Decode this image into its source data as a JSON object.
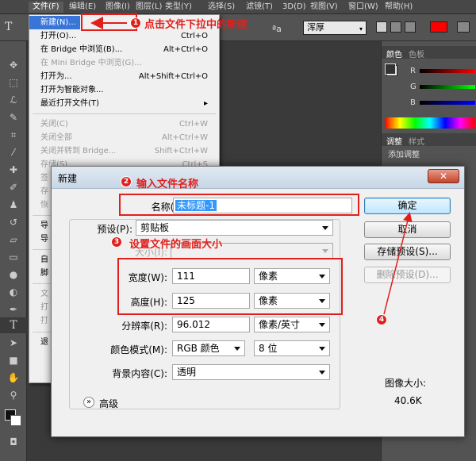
{
  "menubar": {
    "items": [
      "文件(F)",
      "编辑(E)",
      "图像(I)",
      "图层(L)",
      "类型(Y)",
      "选择(S)",
      "滤镜(T)",
      "3D(D)",
      "视图(V)",
      "窗口(W)",
      "帮助(H)"
    ]
  },
  "options_bar": {
    "text_tool_letter": "T",
    "font_size_glyph": "ªa",
    "antialias_value": "浑厚",
    "accent_color": "#ff0000"
  },
  "file_menu": {
    "items": [
      {
        "label": "新建(N)...",
        "shortcut": "",
        "disabled": false,
        "highlighted": true
      },
      {
        "label": "打开(O)...",
        "shortcut": "Ctrl+O",
        "disabled": false
      },
      {
        "label": "在 Bridge 中浏览(B)...",
        "shortcut": "Alt+Ctrl+O",
        "disabled": false
      },
      {
        "label": "在 Mini Bridge 中浏览(G)...",
        "shortcut": "",
        "disabled": true
      },
      {
        "label": "打开为...",
        "shortcut": "Alt+Shift+Ctrl+O",
        "disabled": false
      },
      {
        "label": "打开为智能对象...",
        "shortcut": "",
        "disabled": false
      },
      {
        "label": "最近打开文件(T)",
        "shortcut": "",
        "disabled": false,
        "submenu": true
      },
      {
        "label": "关闭(C)",
        "shortcut": "Ctrl+W",
        "disabled": true
      },
      {
        "label": "关闭全部",
        "shortcut": "Alt+Ctrl+W",
        "disabled": true
      },
      {
        "label": "关闭并转到 Bridge...",
        "shortcut": "Shift+Ctrl+W",
        "disabled": true
      },
      {
        "label": "存储(S)",
        "shortcut": "Ctrl+S",
        "disabled": true
      },
      {
        "label": "签",
        "shortcut": "",
        "disabled": true
      },
      {
        "label": "存",
        "shortcut": "",
        "disabled": true
      },
      {
        "label": "恢",
        "shortcut": "",
        "disabled": true
      },
      {
        "label": "导",
        "shortcut": "",
        "disabled": false
      },
      {
        "label": "导",
        "shortcut": "",
        "disabled": false
      },
      {
        "label": "自",
        "shortcut": "",
        "disabled": false
      },
      {
        "label": "脚",
        "shortcut": "",
        "disabled": false
      },
      {
        "label": "文",
        "shortcut": "",
        "disabled": true
      },
      {
        "label": "打",
        "shortcut": "",
        "disabled": true
      },
      {
        "label": "打",
        "shortcut": "",
        "disabled": true
      },
      {
        "label": "退",
        "shortcut": "",
        "disabled": false
      }
    ]
  },
  "right_panel": {
    "tabs_top": [
      "颜色",
      "色板"
    ],
    "color_labels": [
      "R",
      "G",
      "B"
    ],
    "tabs_mid": [
      "调整",
      "样式"
    ],
    "adjust_label": "添加调整"
  },
  "dialog": {
    "title": "新建",
    "close_glyph": "✕",
    "name_label": "名称(N):",
    "name_value": "未标题-1",
    "preset_label": "预设(P):",
    "preset_value": "剪贴板",
    "size_label": "大小(I):",
    "width_label": "宽度(W):",
    "width_value": "111",
    "width_unit": "像素",
    "height_label": "高度(H):",
    "height_value": "125",
    "height_unit": "像素",
    "resolution_label": "分辨率(R):",
    "resolution_value": "96.012",
    "resolution_unit": "像素/英寸",
    "color_mode_label": "颜色模式(M):",
    "color_mode_value": "RGB 颜色",
    "bit_depth_value": "8 位",
    "background_label": "背景内容(C):",
    "background_value": "透明",
    "advanced_label": "高级",
    "image_size_label": "图像大小:",
    "image_size_value": "40.6K",
    "ok_button": "确定",
    "cancel_button": "取消",
    "save_preset_button": "存储预设(S)...",
    "delete_preset_button": "删除预设(D)..."
  },
  "annotations": {
    "step1_num": "1",
    "step1_text": "点击文件下拉中的新建",
    "step2_num": "2",
    "step2_text": "输入文件名称",
    "step3_num": "3",
    "step3_text": "设置文件的画面大小",
    "step4_num": "4",
    "color": "#e0201c"
  }
}
